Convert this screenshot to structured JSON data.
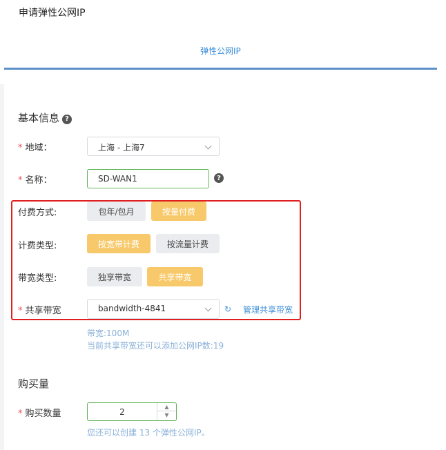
{
  "header": {
    "title": "申请弹性公网IP",
    "tab": "弹性公网IP"
  },
  "basic": {
    "title": "基本信息",
    "region": {
      "label": "地域：",
      "value": "上海 - 上海7"
    },
    "name": {
      "label": "名称：",
      "value": "SD-WAN1"
    },
    "payment": {
      "label": "付费方式:",
      "options": [
        "包年/包月",
        "按量付费"
      ],
      "selected": "按量付费"
    },
    "billing": {
      "label": "计费类型:",
      "options": [
        "按宽带计费",
        "按流量计费"
      ],
      "selected": "按宽带计费"
    },
    "bandwidth_type": {
      "label": "带宽类型:",
      "options": [
        "独享带宽",
        "共享带宽"
      ],
      "selected": "共享带宽"
    },
    "shared": {
      "label": "共享带宽",
      "value": "bandwidth-4841",
      "manage_link": "管理共享带宽",
      "hint1": "带宽:100M",
      "hint2": "当前共享带宽还可以添加公网IP数:19"
    }
  },
  "purchase": {
    "title": "购买量",
    "quantity": {
      "label": "购买数量",
      "value": "2",
      "hint": "您还可以创建 13 个弹性公网IP。"
    }
  },
  "icons": {
    "help": "?",
    "refresh": "↻",
    "up": "▲",
    "down": "▼"
  }
}
